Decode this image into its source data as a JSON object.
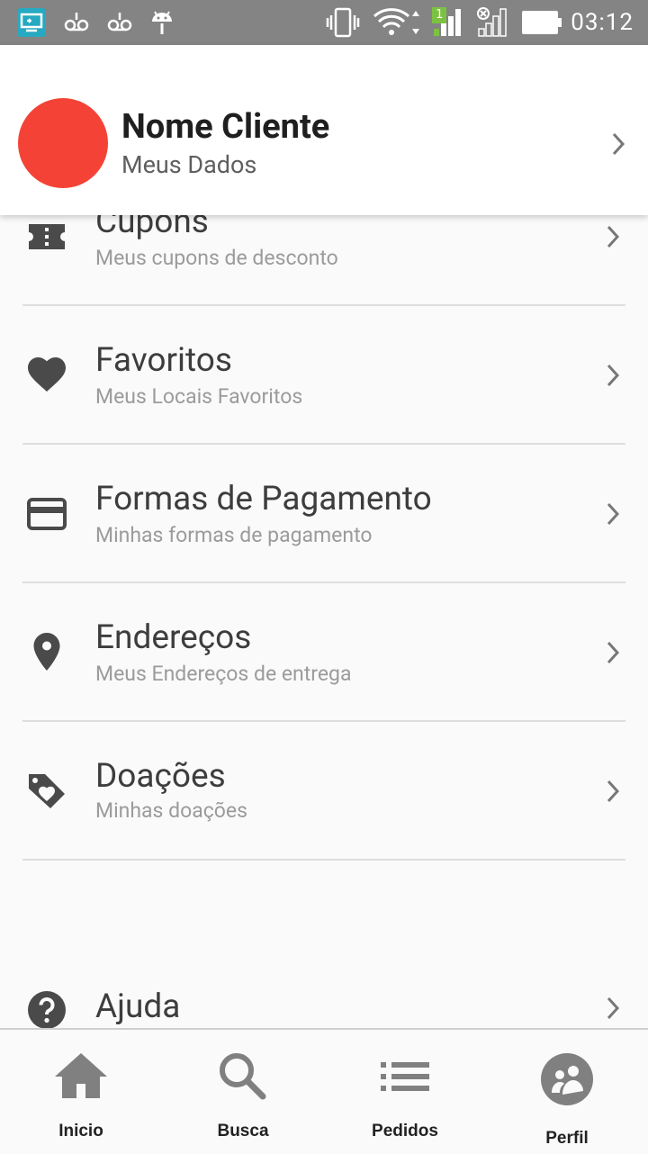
{
  "status_bar": {
    "time": "03:12",
    "signal_sim_badge": "1",
    "icons": [
      "screen-mirror-icon",
      "voicemail-icon",
      "voicemail-icon",
      "android-icon",
      "vibrate-icon",
      "wifi-icon",
      "signal-icon",
      "no-signal-icon",
      "battery-icon"
    ]
  },
  "profile": {
    "name": "Nome Cliente",
    "subtitle": "Meus Dados",
    "avatar_color": "#f44336"
  },
  "menu": {
    "items": [
      {
        "title": "Cupons",
        "subtitle": "Meus cupons de desconto",
        "icon": "ticket-icon"
      },
      {
        "title": "Favoritos",
        "subtitle": "Meus Locais Favoritos",
        "icon": "heart-icon"
      },
      {
        "title": "Formas de Pagamento",
        "subtitle": "Minhas formas de pagamento",
        "icon": "credit-card-icon"
      },
      {
        "title": "Endereços",
        "subtitle": "Meus Endereços de entrega",
        "icon": "location-pin-icon"
      },
      {
        "title": "Doações",
        "subtitle": "Minhas doações",
        "icon": "donation-tag-icon"
      }
    ],
    "help": {
      "title": "Ajuda",
      "icon": "help-icon"
    }
  },
  "bottom_nav": {
    "items": [
      {
        "label": "Inicio",
        "icon": "home-icon"
      },
      {
        "label": "Busca",
        "icon": "search-icon"
      },
      {
        "label": "Pedidos",
        "icon": "list-icon"
      },
      {
        "label": "Perfil",
        "icon": "profile-icon"
      }
    ],
    "active": "Perfil"
  }
}
